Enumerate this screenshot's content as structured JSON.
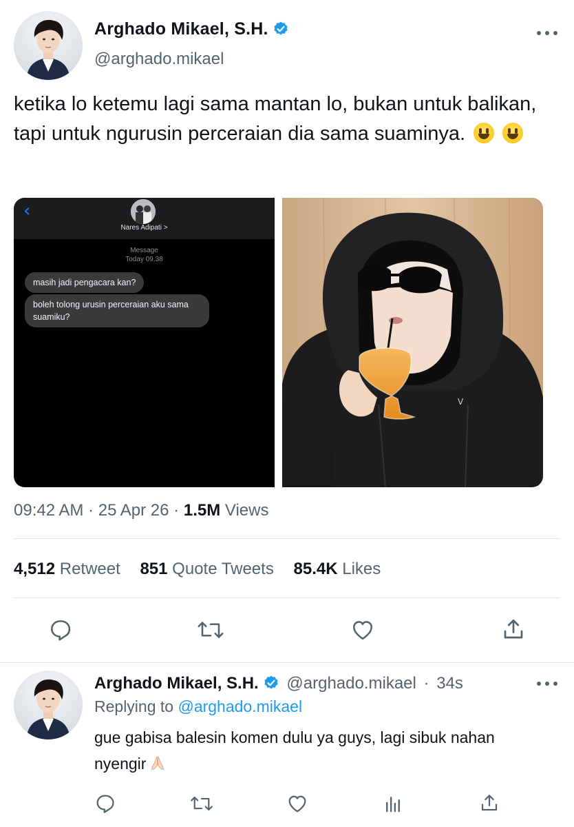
{
  "tweet": {
    "author_name": "Arghado Mikael, S.H.",
    "author_handle": "@arghado.mikael",
    "text": "ketika lo ketemu lagi sama mantan lo, bukan untuk balikan, tapi untuk ngurusin perceraian dia sama suaminya.",
    "emojis": [
      "grinning-face-emoji",
      "grinning-face-emoji"
    ],
    "time": "09:42 AM",
    "date": "25 Apr 26",
    "views_count": "1.5M",
    "views_label": "Views",
    "sep": "·",
    "retweets_count": "4,512",
    "retweets_label": "Retweet",
    "quotes_count": "851",
    "quotes_label": "Quote Tweets",
    "likes_count": "85.4K",
    "likes_label": "Likes"
  },
  "screenshot": {
    "back_glyph": "‹",
    "contact": "Nares Adipati >",
    "service": "Message",
    "timestamp": "Today 09.38",
    "messages": [
      "masih jadi pengacara kan?",
      "boleh tolong urusin perceraian aku sama suamiku?"
    ]
  },
  "reply": {
    "author_name": "Arghado Mikael, S.H.",
    "author_handle": "@arghado.mikael",
    "sep": "·",
    "age": "34s",
    "replying_prefix": "Replying to",
    "replying_to": "@arghado.mikael",
    "text": "gue gabisa balesin komen dulu ya guys, lagi sibuk nahan nyengir",
    "emoji": "folded-hands-emoji"
  },
  "icons": {
    "verified": "verified-badge-icon",
    "more": "more-icon",
    "reply": "reply-icon",
    "retweet": "retweet-icon",
    "like": "like-icon",
    "share": "share-icon",
    "analytics": "analytics-icon"
  },
  "colors": {
    "accent": "#1d9bf0",
    "text": "#0f1419",
    "muted": "#536471",
    "divider": "#e1e6ea"
  }
}
